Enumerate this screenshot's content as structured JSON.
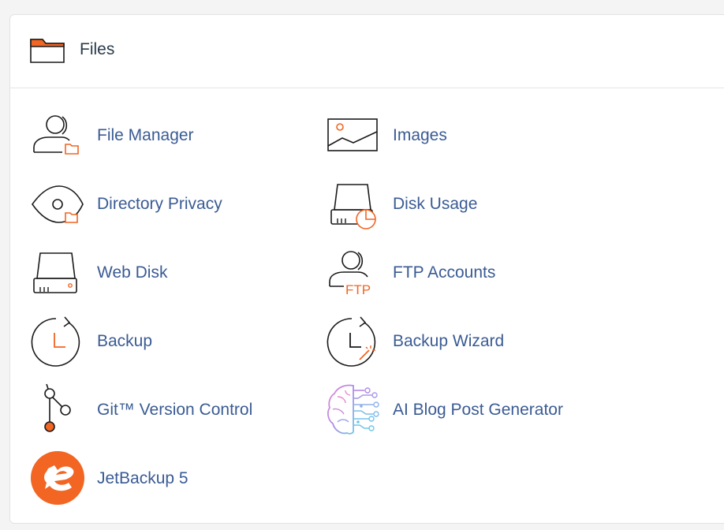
{
  "section": {
    "title": "Files",
    "icon": "folder-icon"
  },
  "colors": {
    "accent": "#f26522",
    "link": "#3a5b94",
    "title": "#293a4a"
  },
  "items": [
    {
      "label": "File Manager",
      "icon": "file-manager-icon"
    },
    {
      "label": "Images",
      "icon": "images-icon"
    },
    {
      "label": "Directory Privacy",
      "icon": "directory-privacy-icon"
    },
    {
      "label": "Disk Usage",
      "icon": "disk-usage-icon"
    },
    {
      "label": "Web Disk",
      "icon": "web-disk-icon"
    },
    {
      "label": "FTP Accounts",
      "icon": "ftp-accounts-icon",
      "icon_text": "FTP"
    },
    {
      "label": "Backup",
      "icon": "backup-icon"
    },
    {
      "label": "Backup Wizard",
      "icon": "backup-wizard-icon"
    },
    {
      "label": "Git™ Version Control",
      "icon": "git-icon"
    },
    {
      "label": "AI Blog Post Generator",
      "icon": "ai-brain-icon"
    },
    {
      "label": "JetBackup 5",
      "icon": "jetbackup-logo-icon"
    }
  ]
}
